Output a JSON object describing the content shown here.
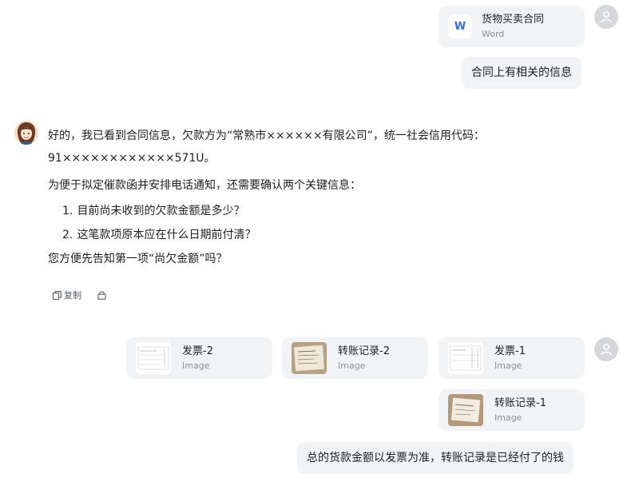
{
  "user_files_top": {
    "name": "货物买卖合同",
    "type": "Word",
    "icon_letter": "W"
  },
  "user_msg_1": "合同上有相关的信息",
  "bot": {
    "line1": "好的，我已看到合同信息，欠款方为“常熟市××××××有限公司”，统一社会信用代码：",
    "line2": "91××××××××××××571U。",
    "para2": "为便于拟定催款函并安排电话通知，还需要确认两个关键信息：",
    "items": [
      {
        "num": "1.",
        "text": "目前尚未收到的欠款金额是多少？"
      },
      {
        "num": "2.",
        "text": "这笔款项原本应在什么日期前付清？"
      }
    ],
    "para3": "您方便先告知第一项“尚欠金额”吗？",
    "actions": {
      "copy_label": "复制"
    }
  },
  "user_files_bottom": [
    {
      "name": "发票-2",
      "type": "Image"
    },
    {
      "name": "转账记录-2",
      "type": "Image"
    },
    {
      "name": "发票-1",
      "type": "Image"
    },
    {
      "name": "转账记录-1",
      "type": "Image"
    }
  ],
  "user_msg_2": "总的货款金额以发票为准，转账记录是已经付了的钱",
  "icons": {
    "user_avatar": "user-silhouette-icon",
    "copy": "copy-icon",
    "share": "lock-icon"
  }
}
